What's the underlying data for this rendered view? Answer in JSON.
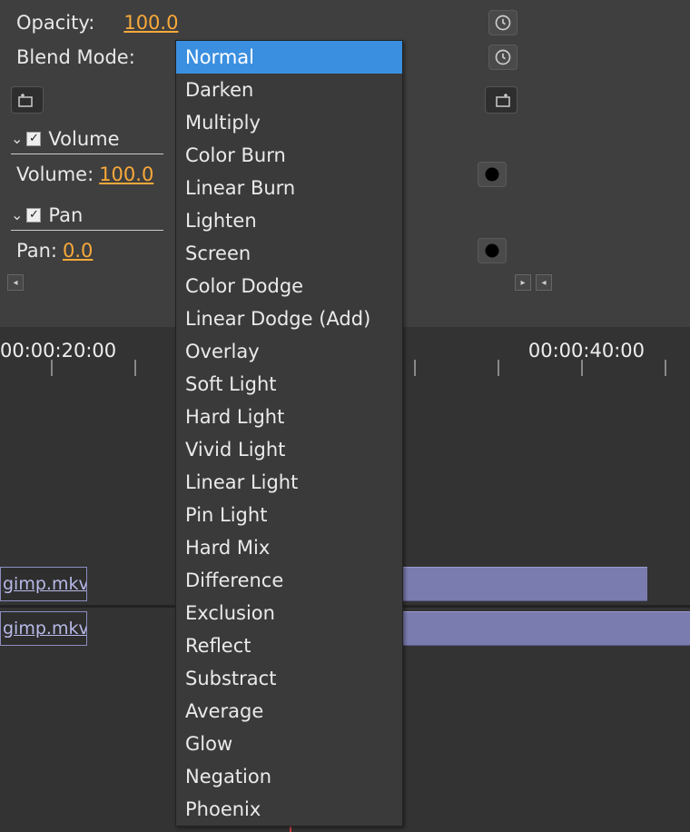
{
  "opacity": {
    "label": "Opacity:",
    "value": "100.0"
  },
  "blend_mode": {
    "label": "Blend Mode:",
    "selected": "Normal",
    "options": [
      "Normal",
      "Darken",
      "Multiply",
      "Color Burn",
      "Linear Burn",
      "Lighten",
      "Screen",
      "Color Dodge",
      "Linear Dodge (Add)",
      "Overlay",
      "Soft Light",
      "Hard Light",
      "Vivid Light",
      "Linear Light",
      "Pin Light",
      "Hard Mix",
      "Difference",
      "Exclusion",
      "Reflect",
      "Substract",
      "Average",
      "Glow",
      "Negation",
      "Phoenix"
    ]
  },
  "volume_section": {
    "title": "Volume",
    "label": "Volume:",
    "value": "100.0",
    "expanded": true,
    "checked": true
  },
  "pan_section": {
    "title": "Pan",
    "label": "Pan:",
    "value": "0.0",
    "expanded": true,
    "checked": true
  },
  "timeline": {
    "timecode_left": "00:00:20:00",
    "timecode_right": "00:00:40:00",
    "clips": [
      {
        "name": "gimp.mkv"
      },
      {
        "name": "gimp.mkv"
      }
    ]
  },
  "icons": {
    "check": "✓",
    "chev_down": "⌄",
    "tri_left": "◂",
    "tri_right": "▸"
  }
}
